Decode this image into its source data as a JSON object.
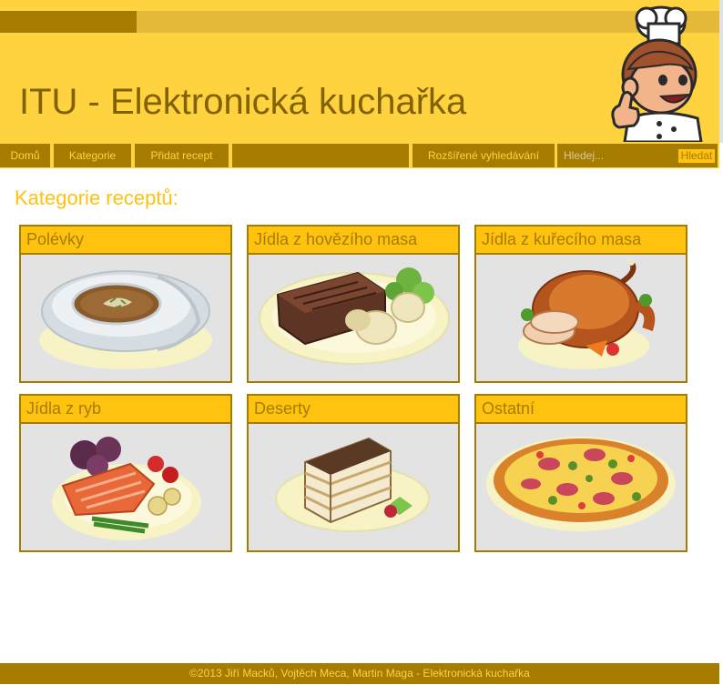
{
  "header": {
    "site_title": "ITU - Elektronická kuchařka",
    "mascot_icon": "chef-mascot-icon"
  },
  "nav": {
    "items": [
      {
        "label": "Domů"
      },
      {
        "label": "Kategorie"
      },
      {
        "label": "Přidat recept"
      },
      {
        "label": ""
      },
      {
        "label": "Rozšířené vyhledávání"
      }
    ],
    "search": {
      "placeholder": "Hledej...",
      "value": "",
      "button_label": "Hledat"
    }
  },
  "main": {
    "title": "Kategorie receptů:",
    "categories": [
      {
        "label": "Polévky",
        "icon": "soup-bowl-icon"
      },
      {
        "label": "Jídla z hovězího masa",
        "icon": "beef-steak-icon"
      },
      {
        "label": "Jídla z kuřecího masa",
        "icon": "roast-chicken-icon"
      },
      {
        "label": "Jídla z ryb",
        "icon": "salmon-fillet-icon"
      },
      {
        "label": "Deserty",
        "icon": "tiramisu-icon"
      },
      {
        "label": "Ostatní",
        "icon": "pizza-icon"
      }
    ]
  },
  "footer": {
    "text": "©2013 Jiří Macků, Vojtěch Meca, Martin Maga - Elektronická kuchařka"
  },
  "colors": {
    "header_yellow": "#ffd340",
    "dark_gold": "#a67c00",
    "accent_yellow": "#ffc20e",
    "card_background": "#e3e3e3"
  }
}
